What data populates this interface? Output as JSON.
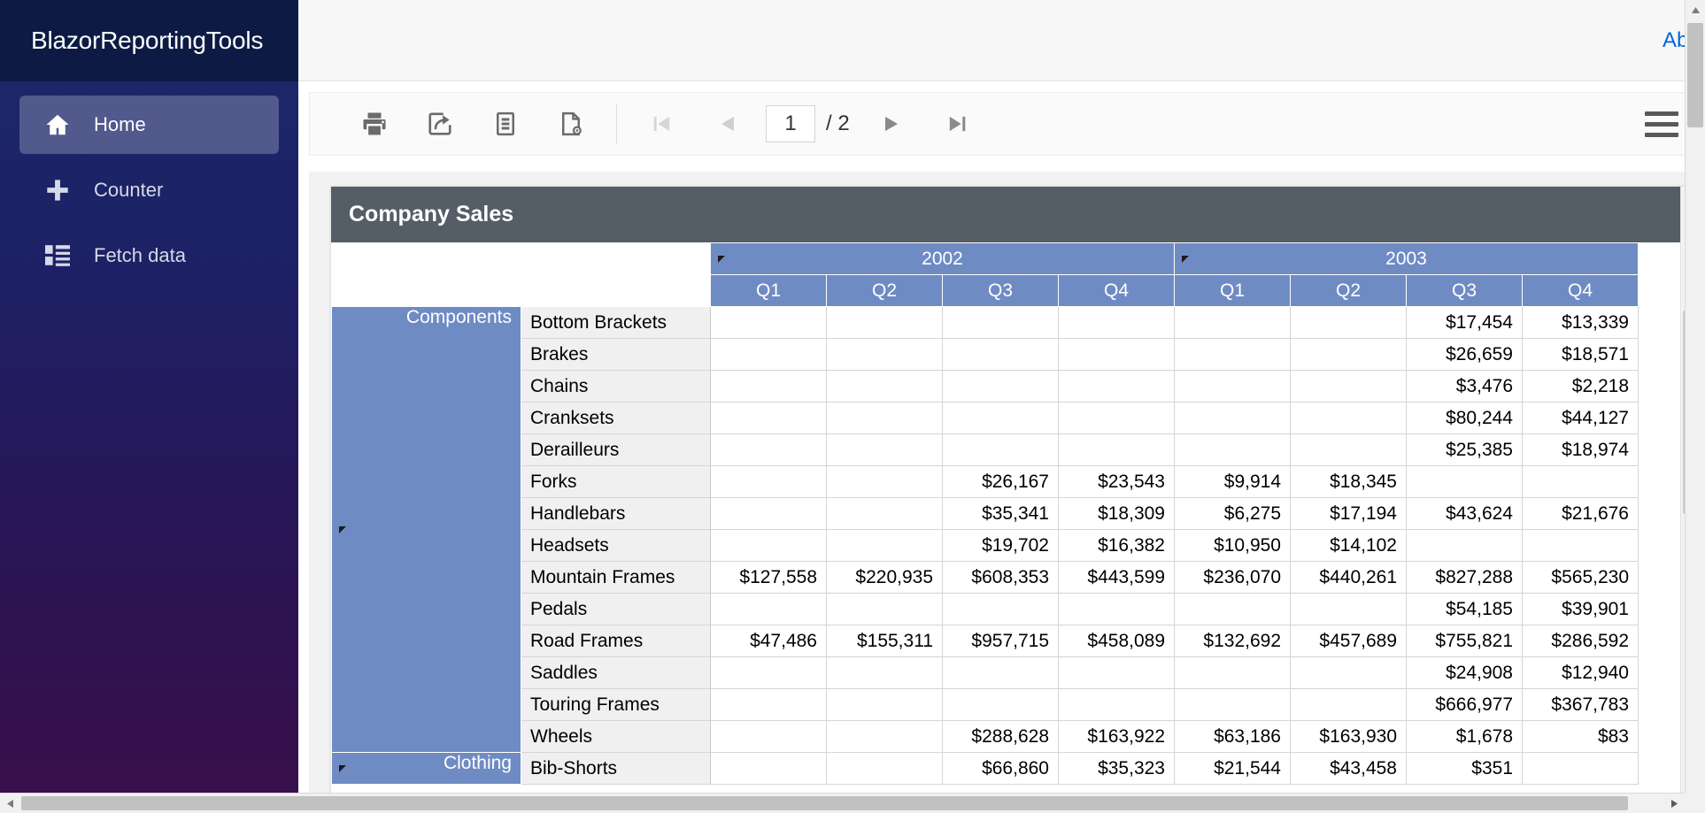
{
  "sidebar": {
    "brand": "BlazorReportingTools",
    "items": [
      {
        "label": "Home",
        "icon": "home-icon",
        "active": true
      },
      {
        "label": "Counter",
        "icon": "plus-icon",
        "active": false
      },
      {
        "label": "Fetch data",
        "icon": "list-icon",
        "active": false
      }
    ]
  },
  "topbar": {
    "about_link": "About"
  },
  "report_toolbar": {
    "buttons": [
      {
        "name": "print-button",
        "icon": "printer-icon",
        "label": "Print"
      },
      {
        "name": "export-button",
        "icon": "export-share-icon",
        "label": "Export"
      },
      {
        "name": "document-map-button",
        "icon": "document-map-icon",
        "label": "Document Map"
      },
      {
        "name": "parameters-button",
        "icon": "document-settings-icon",
        "label": "Parameters"
      }
    ],
    "nav": {
      "first_label": "First Page",
      "prev_label": "Previous Page",
      "next_label": "Next Page",
      "last_label": "Last Page",
      "first_enabled": false,
      "prev_enabled": false,
      "next_enabled": true,
      "last_enabled": true
    },
    "page_current": "1",
    "page_total": "/ 2",
    "page_placeholder": "1",
    "menu_label": "Menu"
  },
  "report": {
    "title": "Company Sales",
    "col_groups": [
      {
        "label": "2002",
        "sub": [
          "Q1",
          "Q2",
          "Q3",
          "Q4"
        ]
      },
      {
        "label": "2003",
        "sub": [
          "Q1",
          "Q2",
          "Q3",
          "Q4"
        ]
      }
    ],
    "row_groups": [
      {
        "label": "Components",
        "rows": [
          {
            "item": "Bottom Brackets",
            "values": [
              "",
              "",
              "",
              "",
              "",
              "",
              "$17,454",
              "$13,339"
            ]
          },
          {
            "item": "Brakes",
            "values": [
              "",
              "",
              "",
              "",
              "",
              "",
              "$26,659",
              "$18,571"
            ]
          },
          {
            "item": "Chains",
            "values": [
              "",
              "",
              "",
              "",
              "",
              "",
              "$3,476",
              "$2,218"
            ]
          },
          {
            "item": "Cranksets",
            "values": [
              "",
              "",
              "",
              "",
              "",
              "",
              "$80,244",
              "$44,127"
            ]
          },
          {
            "item": "Derailleurs",
            "values": [
              "",
              "",
              "",
              "",
              "",
              "",
              "$25,385",
              "$18,974"
            ]
          },
          {
            "item": "Forks",
            "values": [
              "",
              "",
              "$26,167",
              "$23,543",
              "$9,914",
              "$18,345",
              "",
              ""
            ]
          },
          {
            "item": "Handlebars",
            "values": [
              "",
              "",
              "$35,341",
              "$18,309",
              "$6,275",
              "$17,194",
              "$43,624",
              "$21,676"
            ]
          },
          {
            "item": "Headsets",
            "values": [
              "",
              "",
              "$19,702",
              "$16,382",
              "$10,950",
              "$14,102",
              "",
              ""
            ]
          },
          {
            "item": "Mountain Frames",
            "values": [
              "$127,558",
              "$220,935",
              "$608,353",
              "$443,599",
              "$236,070",
              "$440,261",
              "$827,288",
              "$565,230"
            ]
          },
          {
            "item": "Pedals",
            "values": [
              "",
              "",
              "",
              "",
              "",
              "",
              "$54,185",
              "$39,901"
            ]
          },
          {
            "item": "Road Frames",
            "values": [
              "$47,486",
              "$155,311",
              "$957,715",
              "$458,089",
              "$132,692",
              "$457,689",
              "$755,821",
              "$286,592"
            ]
          },
          {
            "item": "Saddles",
            "values": [
              "",
              "",
              "",
              "",
              "",
              "",
              "$24,908",
              "$12,940"
            ]
          },
          {
            "item": "Touring Frames",
            "values": [
              "",
              "",
              "",
              "",
              "",
              "",
              "$666,977",
              "$367,783"
            ]
          },
          {
            "item": "Wheels",
            "values": [
              "",
              "",
              "$288,628",
              "$163,922",
              "$63,186",
              "$163,930",
              "$1,678",
              "$83"
            ]
          }
        ]
      },
      {
        "label": "Clothing",
        "rows": [
          {
            "item": "Bib-Shorts",
            "values": [
              "",
              "",
              "$66,860",
              "$35,323",
              "$21,544",
              "$43,458",
              "$351",
              ""
            ]
          }
        ]
      }
    ]
  }
}
